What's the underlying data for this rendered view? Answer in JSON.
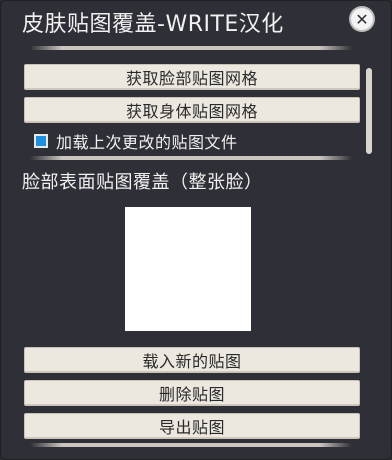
{
  "window": {
    "title": "皮肤贴图覆盖-WRITE汉化",
    "close_glyph": "✕"
  },
  "top_buttons": {
    "get_face_mesh": "获取脸部贴图网格",
    "get_body_mesh": "获取身体贴图网格"
  },
  "option": {
    "load_last_label": "加载上次更改的贴图文件",
    "load_last_checked": true
  },
  "section": {
    "label": "脸部表面贴图覆盖（整张脸）"
  },
  "bottom_buttons": {
    "load_new": "载入新的贴图",
    "delete": "删除贴图",
    "export": "导出贴图"
  },
  "colors": {
    "background": "#2f3037",
    "button": "#ece7df",
    "checkbox_accent": "#1e90e0"
  },
  "icons": [
    "close-icon"
  ]
}
